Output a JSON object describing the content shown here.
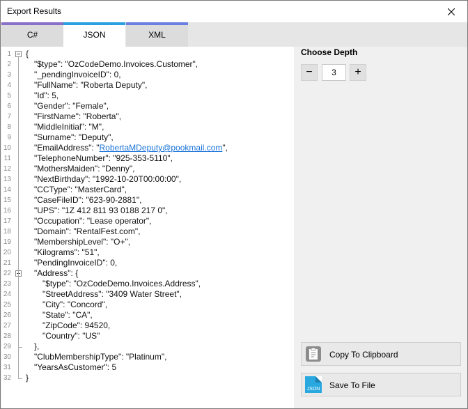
{
  "window": {
    "title": "Export Results"
  },
  "tabs": [
    {
      "label": "C#",
      "accent": "#8a6fc9",
      "active": false
    },
    {
      "label": "JSON",
      "accent": "#2aa0e0",
      "active": true
    },
    {
      "label": "XML",
      "accent": "#6a7fe0",
      "active": false
    }
  ],
  "editor": {
    "lines": [
      {
        "n": "1",
        "indent": 0,
        "fold": true,
        "text": "{"
      },
      {
        "n": "2",
        "indent": 1,
        "text": "\"$type\": \"OzCodeDemo.Invoices.Customer\","
      },
      {
        "n": "3",
        "indent": 1,
        "text": "\"_pendingInvoiceID\": 0,"
      },
      {
        "n": "4",
        "indent": 1,
        "text": "\"FullName\": \"Roberta Deputy\","
      },
      {
        "n": "5",
        "indent": 1,
        "text": "\"Id\": 5,"
      },
      {
        "n": "6",
        "indent": 1,
        "text": "\"Gender\": \"Female\","
      },
      {
        "n": "7",
        "indent": 1,
        "text": "\"FirstName\": \"Roberta\","
      },
      {
        "n": "8",
        "indent": 1,
        "text": "\"MiddleInitial\": \"M\","
      },
      {
        "n": "9",
        "indent": 1,
        "text": "\"Surname\": \"Deputy\","
      },
      {
        "n": "10",
        "indent": 1,
        "text": "\"EmailAddress\": \"",
        "link": "RobertaMDeputy@pookmail.com",
        "after": "\","
      },
      {
        "n": "11",
        "indent": 1,
        "text": "\"TelephoneNumber\": \"925-353-5110\","
      },
      {
        "n": "12",
        "indent": 1,
        "text": "\"MothersMaiden\": \"Denny\","
      },
      {
        "n": "13",
        "indent": 1,
        "text": "\"NextBirthday\": \"1992-10-20T00:00:00\","
      },
      {
        "n": "14",
        "indent": 1,
        "text": "\"CCType\": \"MasterCard\","
      },
      {
        "n": "15",
        "indent": 1,
        "text": "\"CaseFileID\": \"623-90-2881\","
      },
      {
        "n": "16",
        "indent": 1,
        "text": "\"UPS\": \"1Z 412 811 93 0188 217 0\","
      },
      {
        "n": "17",
        "indent": 1,
        "text": "\"Occupation\": \"Lease operator\","
      },
      {
        "n": "18",
        "indent": 1,
        "text": "\"Domain\": \"RentalFest.com\","
      },
      {
        "n": "19",
        "indent": 1,
        "text": "\"MembershipLevel\": \"O+\","
      },
      {
        "n": "20",
        "indent": 1,
        "text": "\"Kilograms\": \"51\","
      },
      {
        "n": "21",
        "indent": 1,
        "text": "\"PendingInvoiceID\": 0,"
      },
      {
        "n": "22",
        "indent": 1,
        "fold": true,
        "text": "\"Address\": {"
      },
      {
        "n": "23",
        "indent": 2,
        "text": "\"$type\": \"OzCodeDemo.Invoices.Address\","
      },
      {
        "n": "24",
        "indent": 2,
        "text": "\"StreetAddress\": \"3409 Water Street\","
      },
      {
        "n": "25",
        "indent": 2,
        "text": "\"City\": \"Concord\","
      },
      {
        "n": "26",
        "indent": 2,
        "text": "\"State\": \"CA\","
      },
      {
        "n": "27",
        "indent": 2,
        "text": "\"ZipCode\": 94520,"
      },
      {
        "n": "28",
        "indent": 2,
        "text": "\"Country\": \"US\""
      },
      {
        "n": "29",
        "indent": 1,
        "text": "},"
      },
      {
        "n": "30",
        "indent": 1,
        "text": "\"ClubMembershipType\": \"Platinum\","
      },
      {
        "n": "31",
        "indent": 1,
        "text": "\"YearsAsCustomer\": 5"
      },
      {
        "n": "32",
        "indent": 0,
        "text": "}"
      }
    ]
  },
  "depth": {
    "label": "Choose Depth",
    "value": "3",
    "minus": "−",
    "plus": "+"
  },
  "actions": {
    "copy_label": "Copy To Clipboard",
    "save_label": "Save To File",
    "save_icon_text": "JSON"
  }
}
